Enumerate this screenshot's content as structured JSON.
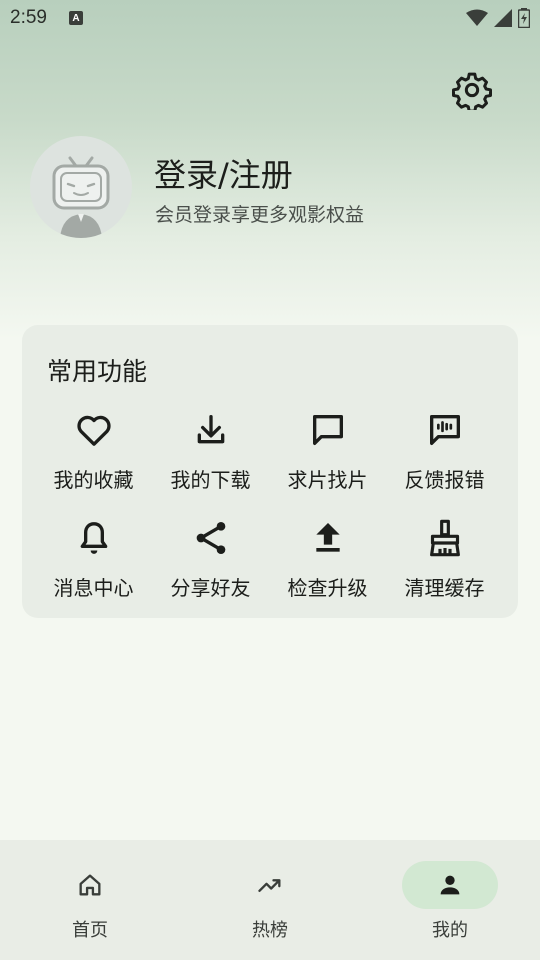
{
  "status_bar": {
    "time": "2:59",
    "notification_icon": "a-icon",
    "icons": [
      "wifi-icon",
      "signal-icon",
      "battery-icon"
    ]
  },
  "header": {
    "settings_icon": "gear-icon",
    "login_title": "登录/注册",
    "login_subtitle": "会员登录享更多观影权益"
  },
  "card": {
    "title": "常用功能",
    "items": [
      {
        "label": "我的收藏",
        "icon": "heart-icon"
      },
      {
        "label": "我的下载",
        "icon": "download-icon"
      },
      {
        "label": "求片找片",
        "icon": "message-icon"
      },
      {
        "label": "反馈报错",
        "icon": "feedback-icon"
      },
      {
        "label": "消息中心",
        "icon": "bell-icon"
      },
      {
        "label": "分享好友",
        "icon": "share-icon"
      },
      {
        "label": "检查升级",
        "icon": "upload-icon"
      },
      {
        "label": "清理缓存",
        "icon": "broom-icon"
      }
    ]
  },
  "bottom_nav": {
    "items": [
      {
        "label": "首页",
        "icon": "home-icon",
        "active": false
      },
      {
        "label": "热榜",
        "icon": "trending-icon",
        "active": false
      },
      {
        "label": "我的",
        "icon": "person-icon",
        "active": true
      }
    ]
  },
  "colors": {
    "background": "#f4f8f1",
    "card": "#e8ede6",
    "active_pill": "#d2e8d2",
    "gradient_top": "#b8cfbd"
  }
}
